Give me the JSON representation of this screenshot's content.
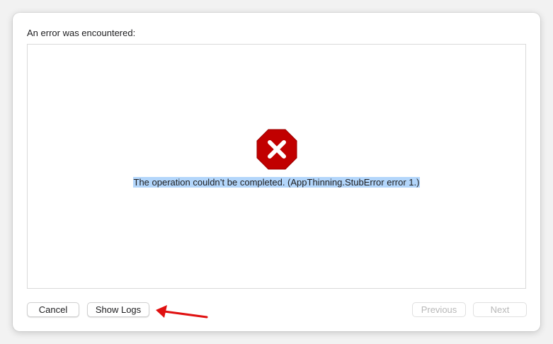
{
  "dialog": {
    "heading": "An error was encountered:",
    "error_message": "The operation couldn’t be completed. (AppThinning.StubError error 1.)",
    "error_icon": "error-octagon-icon",
    "error_color": "#c10000"
  },
  "buttons": {
    "cancel_label": "Cancel",
    "show_logs_label": "Show Logs",
    "previous_label": "Previous",
    "next_label": "Next"
  },
  "annotation": {
    "arrow_color": "#e01010"
  }
}
